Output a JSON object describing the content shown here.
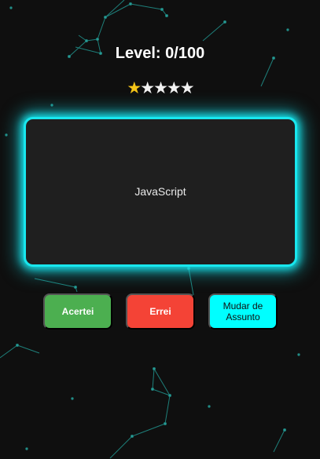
{
  "header": {
    "level_label": "Level: 0/100"
  },
  "rating": {
    "filled": 1,
    "total": 5,
    "glyph": "★",
    "filled_color": "#f5c518",
    "empty_color": "#f2f2f2"
  },
  "card": {
    "text": "JavaScript",
    "glow_color": "#18e7ee"
  },
  "buttons": {
    "correct_label": "Acertei",
    "wrong_label": "Errei",
    "change_subject_label": "Mudar de Assunto"
  },
  "colors": {
    "background": "#0f0f0f",
    "correct": "#4caf50",
    "wrong": "#f44336",
    "change_subject": "#00ffff"
  }
}
